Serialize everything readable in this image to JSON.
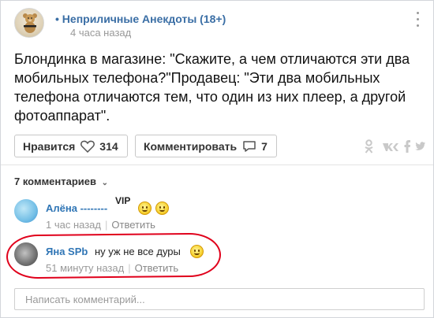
{
  "post": {
    "group_name": "• Неприличные Анекдоты (18+)",
    "time": "4 часа назад",
    "text": "Блондинка в магазине: \"Скажите, а чем отличаются эти два мобильных телефона?\"Продавец: \"Эти два мобильных телефона отличаются тем, что один из них плеер, а другой фотоаппарат\"."
  },
  "actions": {
    "like_label": "Нравится",
    "like_icon": "heart-icon",
    "like_count": "314",
    "comment_label": "Комментировать",
    "comment_icon": "speech-bubble-icon",
    "comment_count": "7",
    "share_icons": [
      "odnoklassniki-icon",
      "vk-icon",
      "facebook-icon",
      "twitter-icon"
    ]
  },
  "comments_header": "7 комментариев",
  "comments": [
    {
      "author": "Алёна --------",
      "badge": "VIP",
      "text": "",
      "emojis": [
        "smile-icon",
        "smile-icon"
      ],
      "time": "1 час назад",
      "reply": "Ответить"
    },
    {
      "author": "Яна SPb",
      "text": "ну уж не все дуры",
      "emojis": [
        "laughing-icon"
      ],
      "time": "51 минуту назад",
      "reply": "Ответить"
    }
  ],
  "comment_input": {
    "placeholder": "Написать комментарий..."
  },
  "colors": {
    "link": "#3a6ea5",
    "author": "#2f75b5",
    "muted": "#999999",
    "highlight": "#e0001b"
  }
}
